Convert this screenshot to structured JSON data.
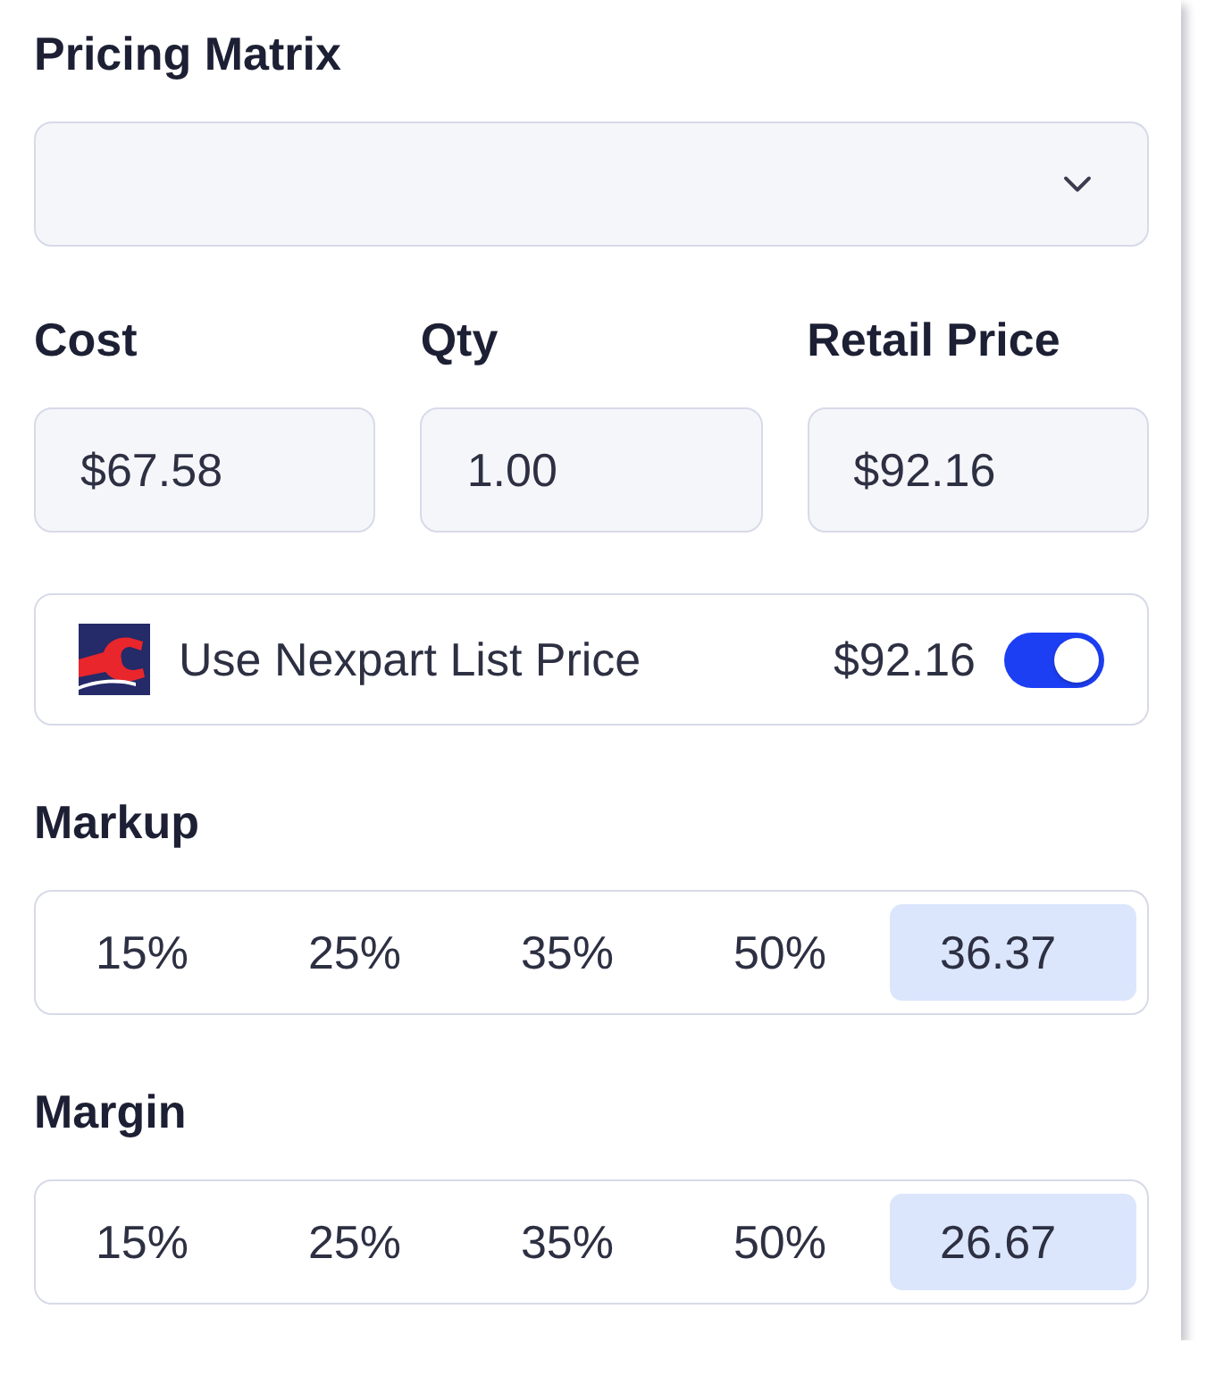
{
  "pricing_matrix": {
    "label": "Pricing Matrix"
  },
  "fields": [
    {
      "label": "Cost",
      "value": "$67.58"
    },
    {
      "label": "Qty",
      "value": "1.00"
    },
    {
      "label": "Retail Price",
      "value": "$92.16"
    }
  ],
  "list_price": {
    "label": "Use Nexpart List Price",
    "price": "$92.16",
    "on": true
  },
  "markup": {
    "label": "Markup",
    "options": [
      {
        "label": "15%",
        "selected": false
      },
      {
        "label": "25%",
        "selected": false
      },
      {
        "label": "35%",
        "selected": false
      },
      {
        "label": "50%",
        "selected": false
      },
      {
        "label": "36.37",
        "selected": true
      }
    ]
  },
  "margin": {
    "label": "Margin",
    "options": [
      {
        "label": "15%",
        "selected": false
      },
      {
        "label": "25%",
        "selected": false
      },
      {
        "label": "35%",
        "selected": false
      },
      {
        "label": "50%",
        "selected": false
      },
      {
        "label": "26.67",
        "selected": true
      }
    ]
  }
}
